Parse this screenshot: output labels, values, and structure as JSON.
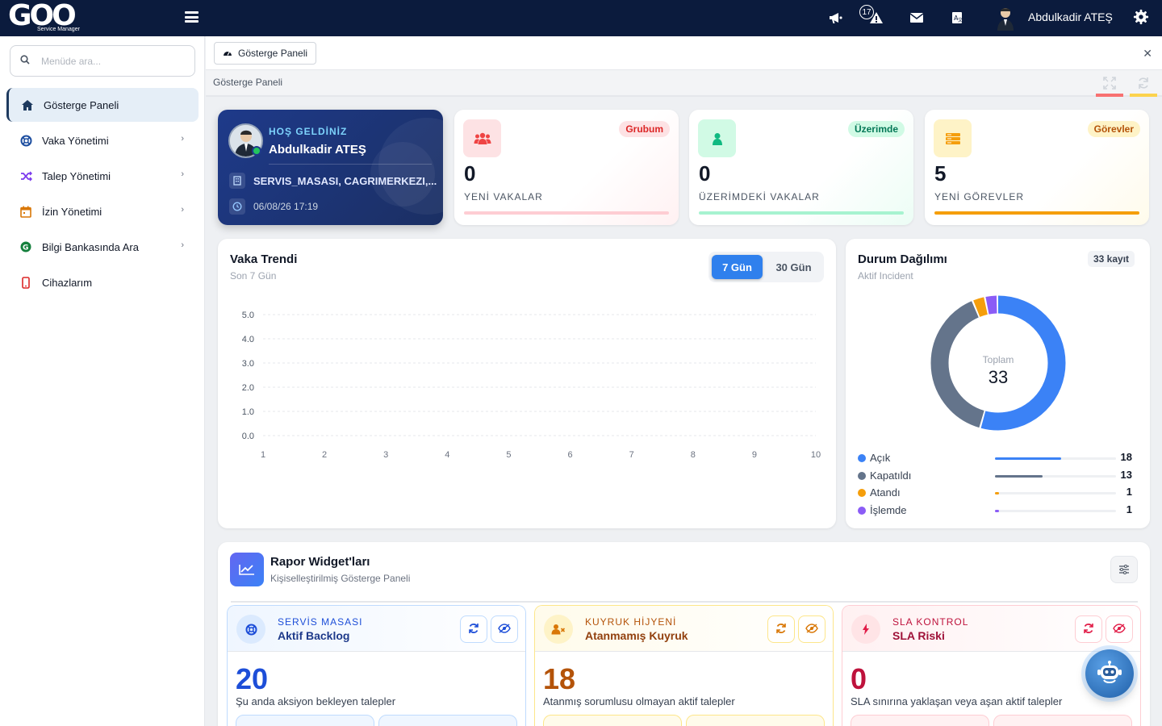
{
  "topbar": {
    "logo_text": "GOO",
    "logo_subtitle": "Service Manager",
    "notification_count": "17",
    "user_name": "Abdulkadir ATEŞ"
  },
  "sidebar": {
    "search_placeholder": "Menüde ara...",
    "items": [
      {
        "label": "Gösterge Paneli",
        "icon": "home-icon"
      },
      {
        "label": "Vaka Yönetimi",
        "icon": "lifebuoy-icon"
      },
      {
        "label": "Talep Yönetimi",
        "icon": "shuffle-icon"
      },
      {
        "label": "İzin Yönetimi",
        "icon": "calendar-icon"
      },
      {
        "label": "Bilgi Bankasında Ara",
        "icon": "google-icon"
      },
      {
        "label": "Cihazlarım",
        "icon": "mobile-icon"
      }
    ]
  },
  "tabs": [
    {
      "label": "Gösterge Paneli"
    }
  ],
  "breadcrumb": "Gösterge Paneli",
  "welcome": {
    "greeting": "HOŞ GELDİNİZ",
    "name": "Abdulkadir ATEŞ",
    "groups": "SERVIS_MASASI, CAGRIMERKEZI,...",
    "datetime": "06/08/26 17:19"
  },
  "stats": [
    {
      "badge": "Grubum",
      "value": "0",
      "label": "YENİ VAKALAR",
      "color": "#ef4444"
    },
    {
      "badge": "Üzerimde",
      "value": "0",
      "label": "ÜZERİMDEKİ VAKALAR",
      "color": "#10b981"
    },
    {
      "badge": "Görevler",
      "value": "5",
      "label": "YENİ GÖREVLER",
      "color": "#f59e0b"
    }
  ],
  "trend": {
    "title": "Vaka Trendi",
    "subtitle": "Son 7 Gün",
    "toggle": [
      "7 Gün",
      "30 Gün"
    ],
    "selected": "7 Gün"
  },
  "chart_data": {
    "type": "line",
    "x": [
      1,
      2,
      3,
      4,
      5,
      6,
      7,
      8,
      9,
      10
    ],
    "y_ticks": [
      "0.0",
      "1.0",
      "2.0",
      "3.0",
      "4.0",
      "5.0"
    ],
    "ylim": [
      0,
      5
    ],
    "series": [],
    "grid": true
  },
  "distribution": {
    "title": "Durum Dağılımı",
    "subtitle": "Aktif Incident",
    "count_badge": "33 kayıt",
    "center_label": "Toplam",
    "total": "33",
    "items": [
      {
        "name": "Açık",
        "value": 18,
        "color": "#3b82f6"
      },
      {
        "name": "Kapatıldı",
        "value": 13,
        "color": "#64748b"
      },
      {
        "name": "Atandı",
        "value": 1,
        "color": "#f59e0b"
      },
      {
        "name": "İşlemde",
        "value": 1,
        "color": "#8b5cf6"
      }
    ]
  },
  "reports": {
    "title": "Rapor Widget'ları",
    "subtitle": "Kişiselleştirilmiş Gösterge Paneli",
    "widgets": [
      {
        "category": "SERVİS MASASI",
        "name": "Aktif Backlog",
        "value": "20",
        "description": "Şu anda aksiyon bekleyen talepler",
        "accent": "#1d4ed8"
      },
      {
        "category": "KUYRUK HİJYENİ",
        "name": "Atanmamış Kuyruk",
        "value": "18",
        "description": "Atanmış sorumlusu olmayan aktif talepler",
        "accent": "#b45309"
      },
      {
        "category": "SLA KONTROL",
        "name": "SLA Riski",
        "value": "0",
        "description": "SLA sınırına yaklaşan veya aşan aktif talepler",
        "accent": "#be123c"
      }
    ]
  }
}
